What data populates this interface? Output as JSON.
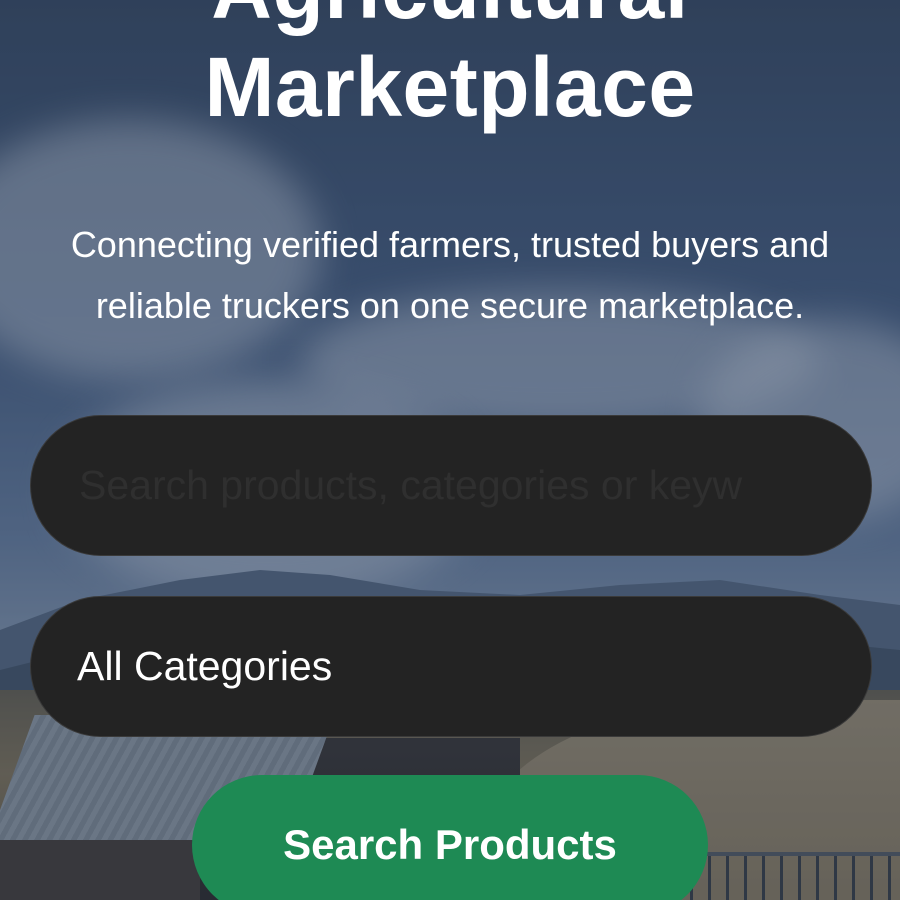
{
  "hero": {
    "title_line_1": "Agricultural",
    "title_line_2": "Marketplace",
    "subtitle": "Connecting verified farmers, trusted buyers and reliable truckers on one secure marketplace."
  },
  "search": {
    "placeholder": "Search products, categories or keyw",
    "value": ""
  },
  "category_select": {
    "selected": "All Categories"
  },
  "search_button": {
    "label": "Search Products"
  },
  "colors": {
    "accent": "#1e8a54",
    "field_background": "#232323",
    "text": "#ffffff"
  }
}
